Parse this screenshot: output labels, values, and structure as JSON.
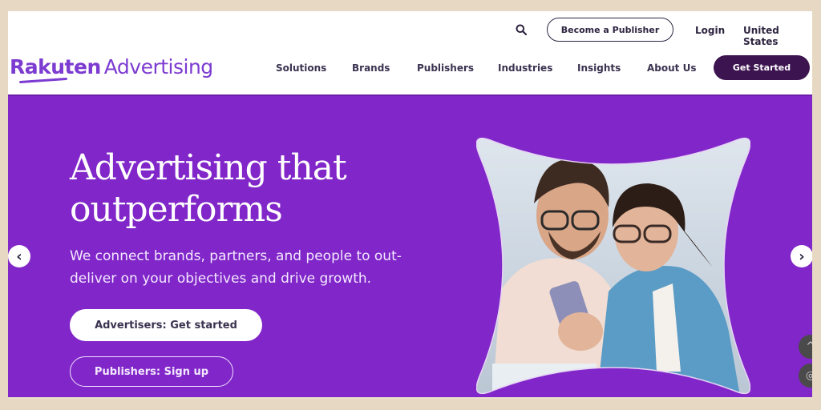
{
  "header": {
    "logo": {
      "brand": "Rakuten",
      "product": "Advertising"
    },
    "utility": {
      "search_icon": "search-icon",
      "become_publisher": "Become a Publisher",
      "login": "Login",
      "country": "United States"
    },
    "nav": [
      {
        "label": "Solutions"
      },
      {
        "label": "Brands"
      },
      {
        "label": "Publishers"
      },
      {
        "label": "Industries"
      },
      {
        "label": "Insights"
      },
      {
        "label": "About Us"
      }
    ],
    "cta": "Get Started"
  },
  "hero": {
    "title": "Advertising that outperforms",
    "subtitle": "We connect brands, partners, and people to out-deliver on your objectives and drive growth.",
    "primary_button": "Advertisers: Get started",
    "secondary_button": "Publishers: Sign up",
    "prev_icon": "‹",
    "next_icon": "›",
    "image_alt": "Two smiling people wearing glasses looking at a smartphone"
  },
  "floating": {
    "scroll_top_icon": "^",
    "fingerprint_icon": "◎"
  },
  "colors": {
    "brand_purple": "#8126c8",
    "logo_purple": "#7c3bd1",
    "dark_cta": "#3c1450",
    "frame": "#e6d8c3"
  }
}
